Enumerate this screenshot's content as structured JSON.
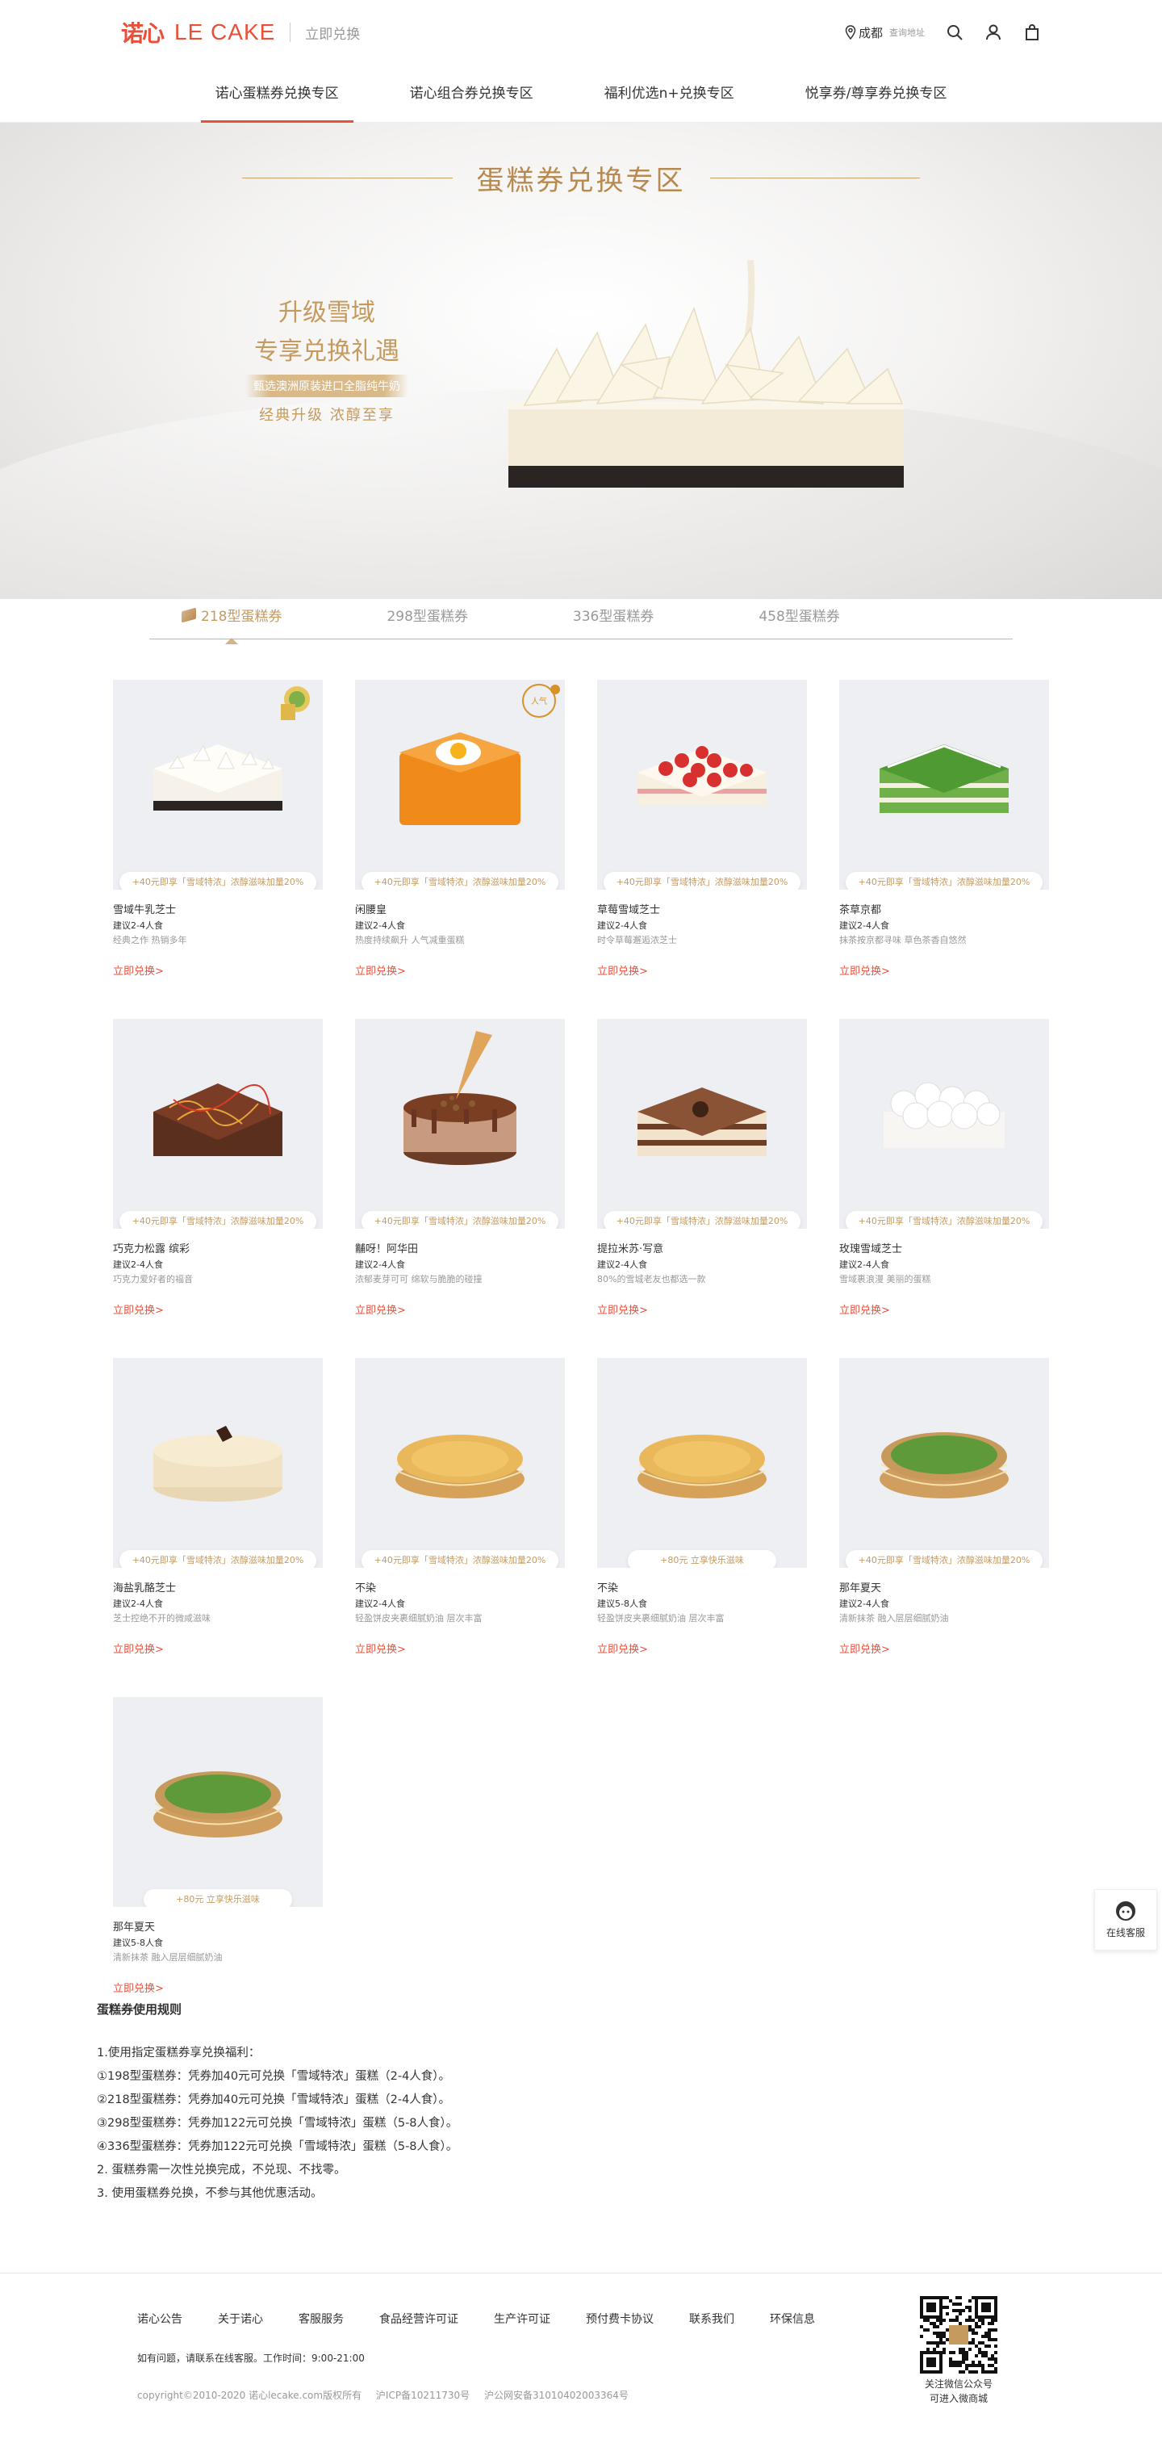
{
  "header": {
    "logo_cn": "诺心",
    "logo_en": "LE CAKE",
    "subtitle": "立即兑换",
    "city": "成都",
    "city_hint": "查询地址",
    "icons": [
      "location-icon",
      "search-icon",
      "user-icon",
      "cart-icon"
    ]
  },
  "nav": {
    "items": [
      {
        "label": "诺心蛋糕券兑换专区",
        "active": true
      },
      {
        "label": "诺心组合券兑换专区",
        "active": false
      },
      {
        "label": "福利优选n+兑换专区",
        "active": false
      },
      {
        "label": "悦享券/尊享券兑换专区",
        "active": false
      }
    ]
  },
  "banner": {
    "title": "蛋糕券兑换专区",
    "line1": "升级雪域",
    "line2": "专享兑换礼遇",
    "line3": "甄选澳洲原装进口全脂纯牛奶",
    "line4": "经典升级  浓醇至享"
  },
  "tabs": [
    {
      "label": "218型蛋糕券",
      "active": true
    },
    {
      "label": "298型蛋糕券",
      "active": false
    },
    {
      "label": "336型蛋糕券",
      "active": false
    },
    {
      "label": "458型蛋糕券",
      "active": false
    }
  ],
  "products": [
    {
      "name": "雪域牛乳芝士",
      "serving": "建议2-4人食",
      "desc": "经典之作 热销多年",
      "badge": "+40元即享「雪域特浓」浓醇滋味加量20%",
      "btn": "立即兑换>",
      "visual": "white-square",
      "tag": "award"
    },
    {
      "name": "闲腰皇",
      "serving": "建议2-4人食",
      "desc": "热度持续飙升 人气减重蛋糕",
      "badge": "+40元即享「雪域特浓」浓醇滋味加量20%",
      "btn": "立即兑换>",
      "visual": "egg-square",
      "tag": "stamp"
    },
    {
      "name": "草莓雪域芝士",
      "serving": "建议2-4人食",
      "desc": "时令草莓邂逅浓芝士",
      "badge": "+40元即享「雪域特浓」浓醇滋味加量20%",
      "btn": "立即兑换>",
      "visual": "strawberry-square",
      "tag": ""
    },
    {
      "name": "茶草京都",
      "serving": "建议2-4人食",
      "desc": "抹茶按京都寻味 草色茶香自悠然",
      "badge": "+40元即享「雪域特浓」浓醇滋味加量20%",
      "btn": "立即兑换>",
      "visual": "matcha-square",
      "tag": ""
    },
    {
      "name": "巧克力松露 缤彩",
      "serving": "建议2-4人食",
      "desc": "巧克力爱好者的福音",
      "badge": "+40元即享「雪域特浓」浓醇滋味加量20%",
      "btn": "立即兑换>",
      "visual": "chocolate-square",
      "tag": ""
    },
    {
      "name": "黼呀！阿华田",
      "serving": "建议2-4人食",
      "desc": "浓郁麦芽可可 绵软与脆脆的碰撞",
      "badge": "+40元即享「雪域特浓」浓醇滋味加量20%",
      "btn": "立即兑换>",
      "visual": "cone-round",
      "tag": ""
    },
    {
      "name": "提拉米苏·写意",
      "serving": "建议2-4人食",
      "desc": "80%的雪城老友也都选一款",
      "badge": "+40元即享「雪域特浓」浓醇滋味加量20%",
      "btn": "立即兑换>",
      "visual": "tiramisu-square",
      "tag": ""
    },
    {
      "name": "玫瑰雪域芝士",
      "serving": "建议2-4人食",
      "desc": "雪域裹浪漫 美丽的蛋糕",
      "badge": "+40元即享「雪域特浓」浓醇滋味加量20%",
      "btn": "立即兑换>",
      "visual": "rose-square",
      "tag": ""
    },
    {
      "name": "海盐乳酪芝士",
      "serving": "建议2-4人食",
      "desc": "芝士控绝不开的微咸滋味",
      "badge": "+40元即享「雪域特浓」浓醇滋味加量20%",
      "btn": "立即兑换>",
      "visual": "cream-round",
      "tag": ""
    },
    {
      "name": "不染",
      "serving": "建议2-4人食",
      "desc": "轻盈饼皮夹裹细腻奶油 层次丰富",
      "badge": "+40元即享「雪域特浓」浓醇滋味加量20%",
      "btn": "立即兑换>",
      "visual": "crepe-round",
      "tag": ""
    },
    {
      "name": "不染",
      "serving": "建议5-8人食",
      "desc": "轻盈饼皮夹裹细腻奶油 层次丰富",
      "badge": "+80元 立享快乐滋味",
      "btn": "立即兑换>",
      "visual": "crepe-round",
      "tag": ""
    },
    {
      "name": "那年夏天",
      "serving": "建议2-4人食",
      "desc": "清新抹茶 融入层层细腻奶油",
      "badge": "+40元即享「雪域特浓」浓醇滋味加量20%",
      "btn": "立即兑换>",
      "visual": "matcha-crepe",
      "tag": ""
    },
    {
      "name": "那年夏天",
      "serving": "建议5-8人食",
      "desc": "清新抹茶 融入层层细腻奶油",
      "badge": "+80元 立享快乐滋味",
      "btn": "立即兑换>",
      "visual": "matcha-crepe",
      "tag": ""
    }
  ],
  "rules": {
    "title": "蛋糕券使用规则",
    "lines": [
      "1.使用指定蛋糕券享兑换福利：",
      "①198型蛋糕券：凭券加40元可兑换「雪域特浓」蛋糕（2-4人食）。",
      "②218型蛋糕券：凭券加40元可兑换「雪域特浓」蛋糕（2-4人食）。",
      "③298型蛋糕券：凭券加122元可兑换「雪域特浓」蛋糕（5-8人食）。",
      "④336型蛋糕券：凭券加122元可兑换「雪域特浓」蛋糕（5-8人食）。",
      "2. 蛋糕券需一次性兑换完成，不兑现、不找零。",
      "3. 使用蛋糕券兑换，不参与其他优惠活动。"
    ]
  },
  "footer": {
    "links": [
      "诺心公告",
      "关于诺心",
      "客服服务",
      "食品经营许可证",
      "生产许可证",
      "预付费卡协议",
      "联系我们",
      "环保信息"
    ],
    "note": "如有问题，请联系在线客服。工作时间：9:00-21:00",
    "copyright": "copyright©2010-2020 诺心lecake.com版权所有",
    "icp": "沪ICP备10211730号",
    "police": "沪公网安备31010402003364号",
    "qr_line1": "关注微信公众号",
    "qr_line2": "可进入微商城"
  },
  "service": {
    "label": "在线客服"
  },
  "colors": {
    "brand": "#e8503a",
    "gold": "#c49a5f",
    "tile_bg": "#eeeff3"
  }
}
